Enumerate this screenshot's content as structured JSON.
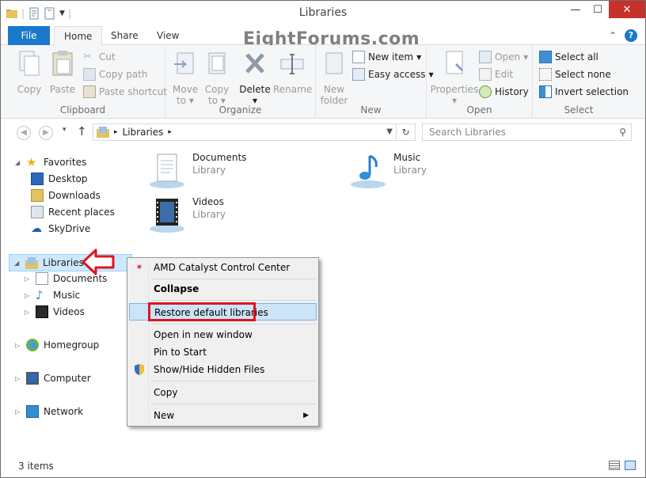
{
  "window": {
    "title": "Libraries"
  },
  "watermark": "EightForums.com",
  "ribbon_tabs": [
    "File",
    "Home",
    "Share",
    "View"
  ],
  "ribbon": {
    "clipboard": {
      "copy": "Copy",
      "paste": "Paste",
      "cut": "Cut",
      "copy_path": "Copy path",
      "paste_shortcut": "Paste shortcut",
      "label": "Clipboard"
    },
    "organize": {
      "move_to": "Move",
      "move_to2": "to",
      "copy_to": "Copy",
      "copy_to2": "to",
      "delete": "Delete",
      "rename": "Rename",
      "label": "Organize"
    },
    "new": {
      "new_folder": "New",
      "new_folder2": "folder",
      "new_item": "New item",
      "easy_access": "Easy access",
      "label": "New"
    },
    "open": {
      "properties": "Properties",
      "open": "Open",
      "edit": "Edit",
      "history": "History",
      "label": "Open"
    },
    "select": {
      "select_all": "Select all",
      "select_none": "Select none",
      "invert": "Invert selection",
      "label": "Select"
    }
  },
  "address": {
    "path": "Libraries",
    "search_placeholder": "Search Libraries"
  },
  "nav": {
    "favorites": "Favorites",
    "desktop": "Desktop",
    "downloads": "Downloads",
    "recent": "Recent places",
    "skydrive": "SkyDrive",
    "libraries": "Libraries",
    "documents": "Documents",
    "music": "Music",
    "videos": "Videos",
    "homegroup": "Homegroup",
    "computer": "Computer",
    "network": "Network"
  },
  "libraries": [
    {
      "name": "Documents",
      "type": "Library"
    },
    {
      "name": "Music",
      "type": "Library"
    },
    {
      "name": "Videos",
      "type": "Library"
    }
  ],
  "context_menu": {
    "amd": "AMD Catalyst Control Center",
    "collapse": "Collapse",
    "restore": "Restore default libraries",
    "open_new": "Open in new window",
    "pin": "Pin to Start",
    "showhide": "Show/Hide Hidden Files",
    "copy": "Copy",
    "new": "New"
  },
  "status": {
    "count": "3 items"
  },
  "colors": {
    "accent": "#1979ca",
    "highlight": "#e0141f",
    "close": "#c7312b"
  }
}
